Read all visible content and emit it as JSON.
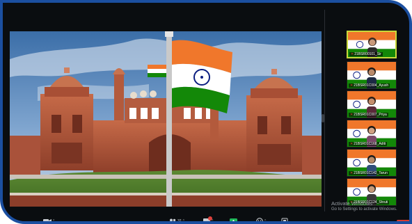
{
  "participants": [
    {
      "name": "21BSR00101_Sir",
      "active": true
    },
    {
      "name": "21BSR01C004_Ayush",
      "active": false
    },
    {
      "name": "21BSR01C007_Priya",
      "active": false
    },
    {
      "name": "21BSR01C168_Aditi",
      "active": false
    },
    {
      "name": "21BSR01C142_Tarun",
      "active": false
    },
    {
      "name": "21BSR01C124_Shruti",
      "active": false
    }
  ],
  "watermark": {
    "line1": "Activate Windows",
    "line2": "Go to Settings to activate Windows."
  },
  "toolbar": {
    "participants_count": "32"
  },
  "colors": {
    "frame_border": "#1b4fa0",
    "background": "#0a0d10",
    "saffron": "#f0772b",
    "green": "#138808",
    "fort_red": "#b85a3e",
    "end_red": "#d93a30"
  },
  "icons": [
    "camera-icon",
    "participants-icon",
    "chat-icon",
    "share-screen-icon",
    "reactions-icon",
    "more-icon"
  ]
}
